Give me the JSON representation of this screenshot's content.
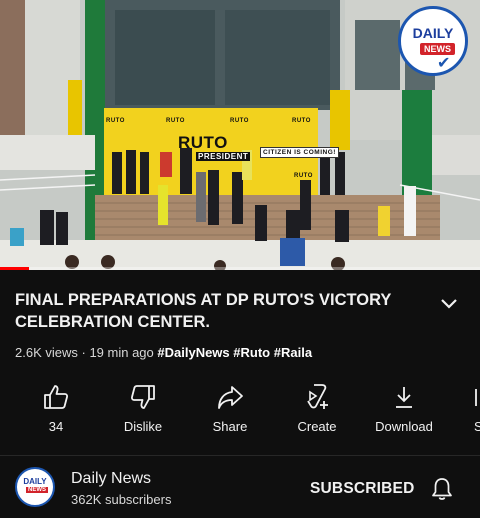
{
  "video": {
    "banner_texts": [
      "RUTO",
      "PRESIDENT",
      "CITIZEN IS COMING!",
      "RUTO",
      "RUTO",
      "RUTO",
      "RUTO",
      "RUTO"
    ],
    "progress_fraction": 0.06,
    "colors": {
      "banner": "#f2d21e",
      "progress": "#ff0000",
      "building": "#c9ccc8"
    }
  },
  "watermark": {
    "line1": "DAILY",
    "line2": "NEWS"
  },
  "video_info": {
    "title": "FINAL PREPARATIONS AT DP RUTO'S VICTORY CELEBRATION CENTER.",
    "views": "2.6K views",
    "age": "· 19 min ago",
    "hashtags": [
      "#DailyNews",
      "#Ruto",
      "#Raila"
    ],
    "expand_icon": "chevron-down-icon"
  },
  "actions": [
    {
      "icon": "thumbs-up-icon",
      "label": "34"
    },
    {
      "icon": "thumbs-down-icon",
      "label": "Dislike"
    },
    {
      "icon": "share-icon",
      "label": "Share"
    },
    {
      "icon": "create-icon",
      "label": "Create"
    },
    {
      "icon": "download-icon",
      "label": "Download"
    },
    {
      "icon": "save-icon",
      "label": "S"
    }
  ],
  "channel": {
    "name": "Daily News",
    "subscribers": "362K subscribers",
    "subscribe_label": "SUBSCRIBED",
    "avatar_line1": "DAILY",
    "avatar_line2": "NEWS",
    "bell_icon": "bell-icon"
  }
}
